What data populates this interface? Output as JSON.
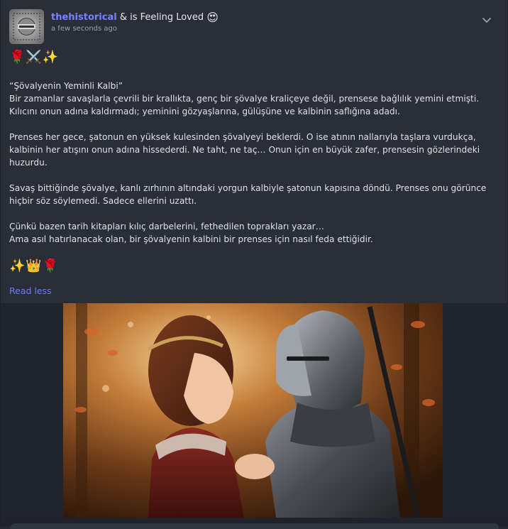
{
  "post": {
    "username": "thehistorical",
    "feeling_text": " & is Feeling Loved ",
    "feeling_emoji": "😍",
    "time": "a few seconds ago",
    "top_emojis": "🌹⚔️✨",
    "title": "“Şövalyenin Yeminli Kalbi”",
    "paragraph1": "Bir zamanlar savaşlarla çevrili bir krallıkta, genç bir şövalye kraliçeye değil, prensese bağlılık yemini etmişti.\nKılıcını onun adına kaldırmadı; yeminini gözyaşlarına, gülüşüne ve kalbinin saflığına adadı.",
    "paragraph2": "Prenses her gece, şatonun en yüksek kulesinden şövalyeyi beklerdi. O ise atının nallarıyla taşlara vurdukça,\nkalbinin her atışını onun adına hissederdi. Ne taht, ne taç… Onun için en büyük zafer, prensesin gözlerindeki\nhuzurdu.",
    "paragraph3": "Savaş bittiğinde şövalye, kanlı zırhının altındaki yorgun kalbiyle şatonun kapısına döndü. Prenses onu görünce\nhiçbir söz söylemedi. Sadece ellerini uzattı.",
    "paragraph4": "Çünkü bazen tarih kitapları kılıç darbelerini, fethedilen toprakları yazar…\nAma asıl hatırlanacak olan, bir şövalyenin kalbini bir prenses için nasıl feda ettiğidir.",
    "bottom_emojis": "✨👑🌹",
    "read_less": "Read less"
  },
  "icons": {
    "menu": "chevron-down-icon"
  },
  "colors": {
    "background": "#2a2e39",
    "username": "#7b80ff",
    "link": "#6d78ff"
  }
}
